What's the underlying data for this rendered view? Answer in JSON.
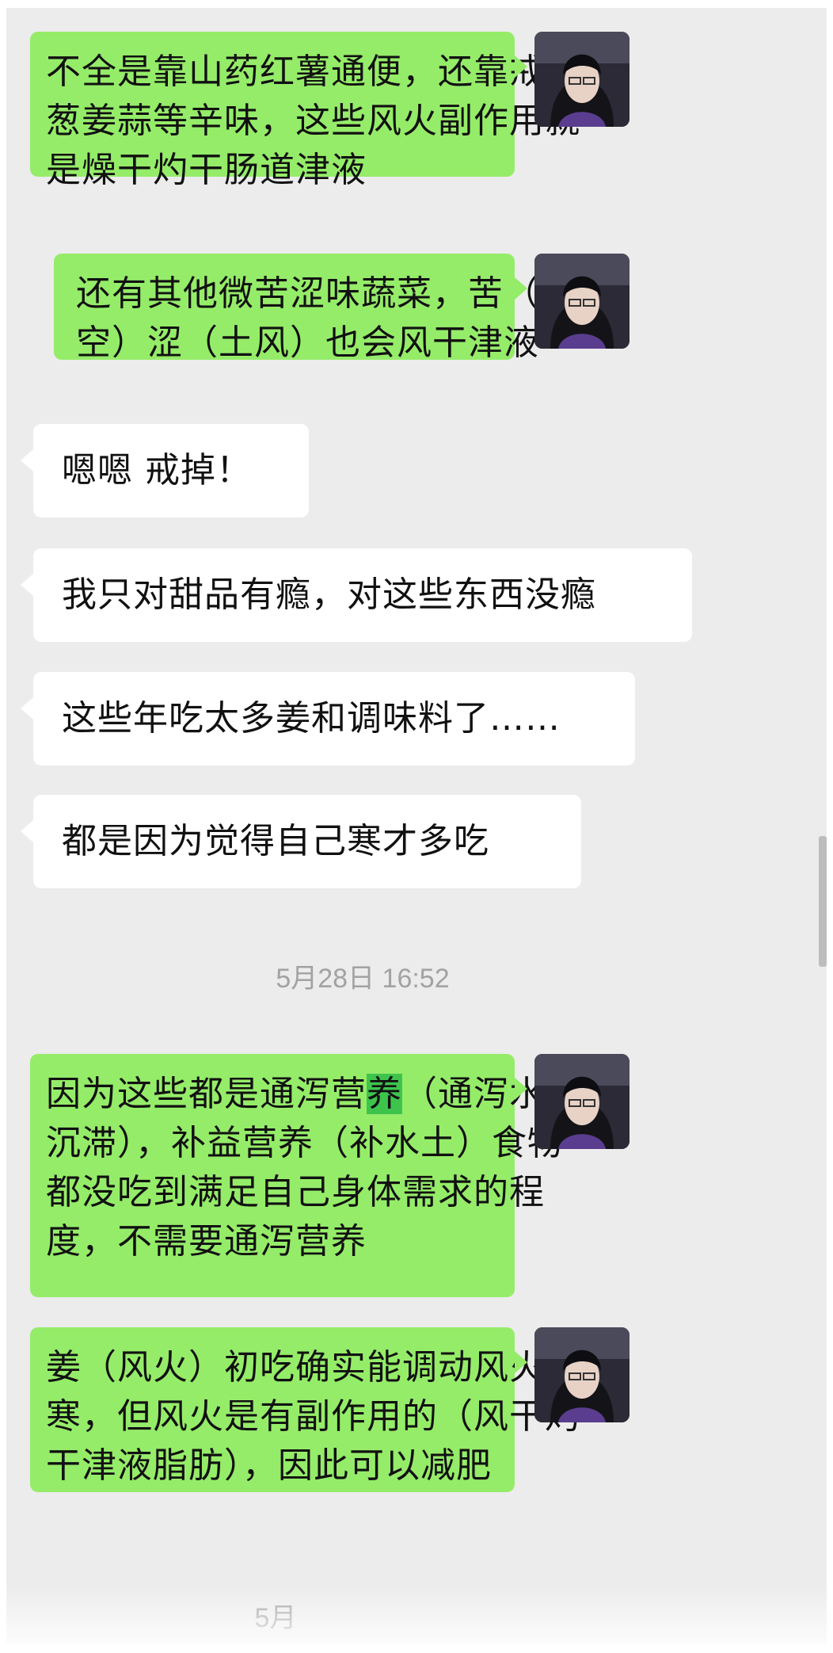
{
  "colors": {
    "chat_background": "#ececec",
    "outgoing_bubble": "#95ec69",
    "incoming_bubble": "#ffffff",
    "highlight": "#3ec44d",
    "timestamp_text": "#a2a2a2"
  },
  "messages": [
    {
      "direction": "outgoing",
      "lines": [
        "不全是靠山药红薯通便，还靠戒减",
        "葱姜蒜等辛味，这些风火副作用就",
        "是燥干灼干肠道津液"
      ]
    },
    {
      "direction": "outgoing",
      "lines": [
        "还有其他微苦涩味蔬菜，苦（风",
        "空）涩（土风）也会风干津液"
      ]
    },
    {
      "direction": "incoming",
      "lines": [
        "嗯嗯 戒掉！"
      ]
    },
    {
      "direction": "incoming",
      "lines": [
        "我只对甜品有瘾，对这些东西没瘾"
      ]
    },
    {
      "direction": "incoming",
      "lines": [
        "这些年吃太多姜和调味料了……"
      ]
    },
    {
      "direction": "incoming",
      "lines": [
        "都是因为觉得自己寒才多吃"
      ]
    },
    {
      "direction": "outgoing",
      "lines": [
        "因为这些都是通泻营",
        "养",
        "（通泻水土",
        "沉滞），补益营养（补水土）食物",
        "都没吃到满足自己身体需求的程",
        "度，不需要通泻营养"
      ]
    },
    {
      "direction": "outgoing",
      "lines": [
        "姜（风火）初吃确实能调动风火抗",
        "寒，但风火是有副作用的（风干灼",
        "干津液脂肪），因此可以减肥"
      ]
    }
  ],
  "timestamps": [
    "5月28日 16:52",
    "5月"
  ],
  "avatar": {
    "icon": "user-avatar-icon"
  }
}
